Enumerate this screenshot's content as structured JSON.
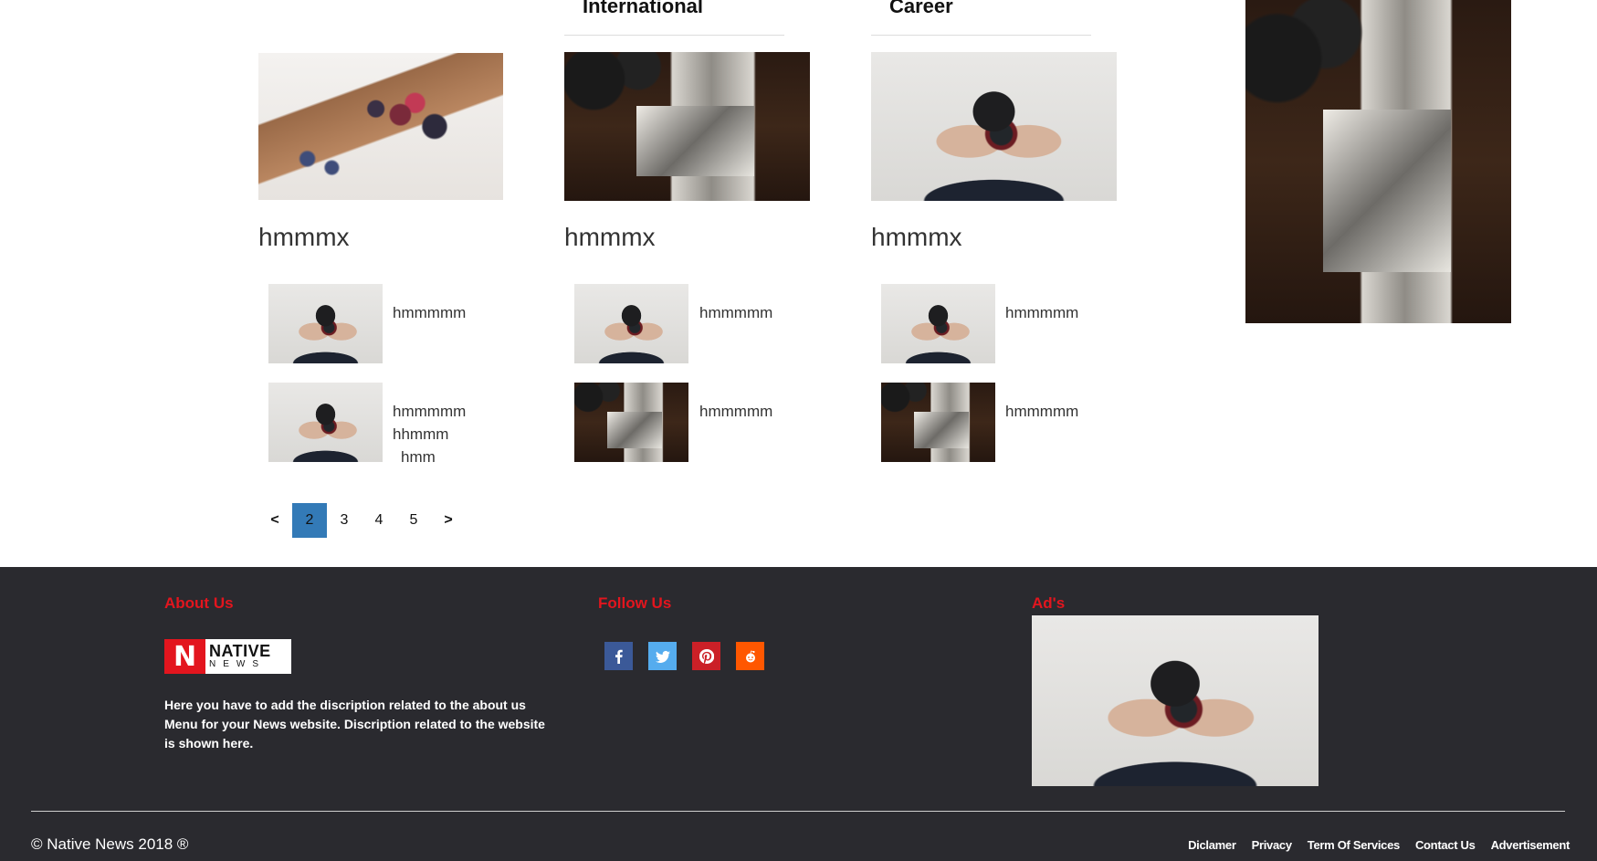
{
  "columns": [
    {
      "title": "",
      "main_caption": "hmmmx",
      "items": [
        {
          "caption": "hmmmmm"
        },
        {
          "caption_lines": [
            "hmmmmm",
            "hhmmm",
            "hmm"
          ]
        }
      ]
    },
    {
      "title": "International",
      "main_caption": "hmmmx",
      "items": [
        {
          "caption": "hmmmmm"
        },
        {
          "caption": "hmmmmm"
        }
      ]
    },
    {
      "title": "Career",
      "main_caption": "hmmmx",
      "items": [
        {
          "caption": "hmmmmm"
        },
        {
          "caption": "hmmmmm"
        }
      ]
    }
  ],
  "pagination": {
    "prev": "<",
    "pages": [
      "2",
      "3",
      "4",
      "5"
    ],
    "active": "2",
    "next": ">",
    "active_color": "#337ab7"
  },
  "footer": {
    "background": "#2a2a2f",
    "heading_color": "#e3151e",
    "about": {
      "heading": "About Us",
      "logo_letter": "N",
      "logo_main": "NATIVE",
      "logo_sub": "NEWS",
      "text": "Here you have to add the discription related to the about us Menu for your News website. Discription related to the website is shown here."
    },
    "follow": {
      "heading": "Follow Us",
      "icons": [
        {
          "name": "facebook-icon",
          "color": "#3b5998"
        },
        {
          "name": "twitter-icon",
          "color": "#55acee"
        },
        {
          "name": "pinterest-icon",
          "color": "#cb2027"
        },
        {
          "name": "reddit-icon",
          "color": "#ff5700"
        }
      ]
    },
    "ads": {
      "heading": "Ad's"
    },
    "copyright": "© Native News 2018 ®",
    "links": [
      "Diclamer",
      "Privacy",
      "Term Of Services",
      "Contact Us",
      "Advertisement"
    ]
  }
}
